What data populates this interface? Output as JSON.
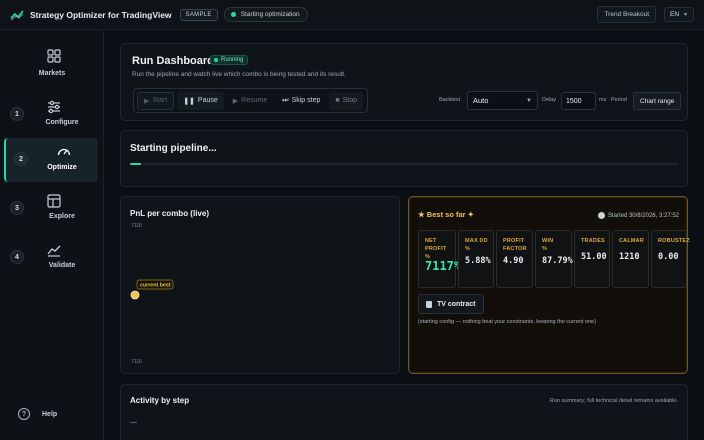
{
  "app": {
    "title": "Strategy Optimizer for TradingView",
    "sample_badge": "SAMPLE",
    "status": "Starting optimization",
    "strategy_button": "Trend Breakout",
    "language": "EN"
  },
  "sidebar": {
    "items": [
      {
        "num": "",
        "label": "Markets",
        "icon": "grid-icon"
      },
      {
        "num": "1",
        "label": "Configure",
        "icon": "sliders-icon"
      },
      {
        "num": "2",
        "label": "Optimize",
        "icon": "gauge-icon",
        "active": true
      },
      {
        "num": "3",
        "label": "Explore",
        "icon": "layout-icon"
      },
      {
        "num": "4",
        "label": "Validate",
        "icon": "chart-line-icon"
      }
    ],
    "help": "Help"
  },
  "run_dashboard": {
    "title": "Run Dashboard",
    "running_badge": "Running",
    "subtitle": "Run the pipeline and watch live which combo is being tested and its result.",
    "controls": {
      "start": "Start",
      "pause": "Pause",
      "resume": "Resume",
      "skip": "Skip step",
      "stop": "Stop"
    },
    "backtest_label": "Backtest",
    "backtest_value": "Auto",
    "delay_label": "Delay",
    "delay_value": "1500",
    "ms_label": "ms",
    "period_label": "Period",
    "chart_range": "Chart range"
  },
  "pipeline": {
    "title": "Starting pipeline...",
    "progress": 0.02
  },
  "pnl_chart": {
    "title": "PnL per combo (live)",
    "y_top": "7118",
    "y_bottom": "7116",
    "marker_label": "current best"
  },
  "chart_data": {
    "type": "scatter",
    "title": "PnL per combo (live)",
    "ylim": [
      7116,
      7118
    ],
    "points": [
      {
        "x": 1,
        "y": 7117,
        "label": "current best"
      }
    ]
  },
  "best_so_far": {
    "title": "★ Best so far ✦",
    "started": "Started 30/8/2026, 3:27:52",
    "metrics": [
      {
        "label": "NET PROFIT %",
        "value": "7117%"
      },
      {
        "label": "MAX DD %",
        "value": "5.88%"
      },
      {
        "label": "PROFIT FACTOR",
        "value": "4.90"
      },
      {
        "label": "WIN %",
        "value": "87.79%"
      },
      {
        "label": "TRADES",
        "value": "51.00"
      },
      {
        "label": "CALMAR",
        "value": "1210"
      },
      {
        "label": "ROBUSTEZ",
        "value": "0.00"
      }
    ],
    "tv_button": "TV contract",
    "note": "(starting config — nothing beat your constraints, keeping the current one)"
  },
  "activity": {
    "title": "Activity by step",
    "subtitle": "Run summary; full technical detail remains available.",
    "placeholder": "—"
  },
  "colors": {
    "accent": "#2fd6a3",
    "gold": "#e0a93b",
    "background": "#0b0f14"
  }
}
